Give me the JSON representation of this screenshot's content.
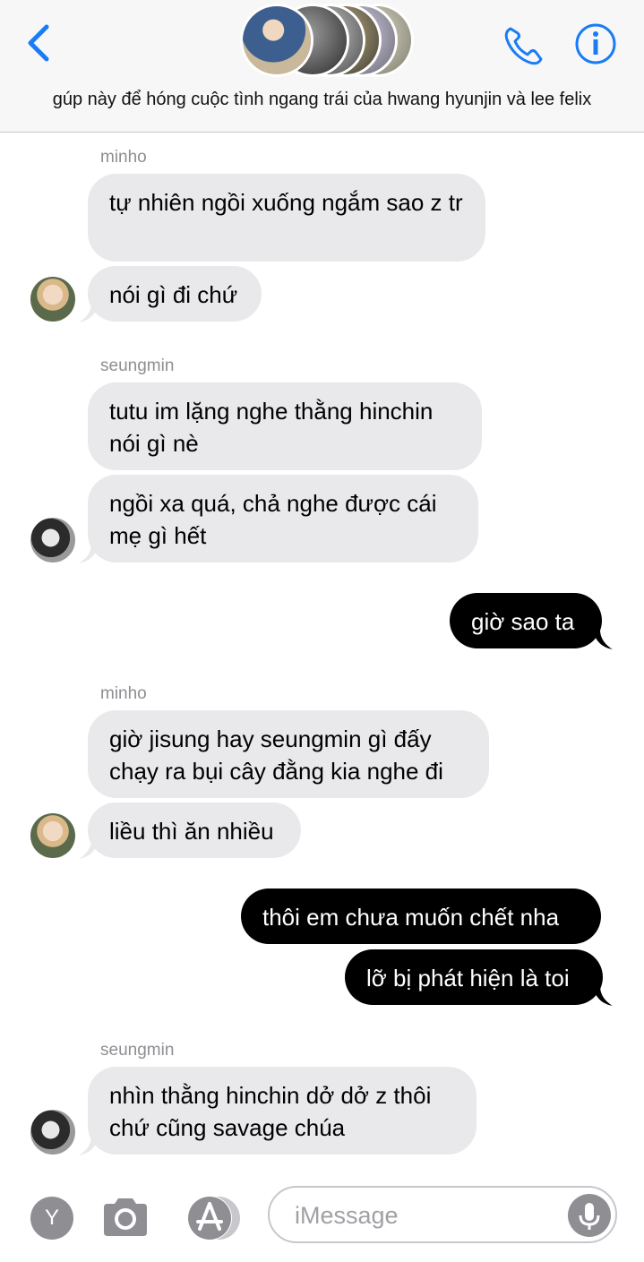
{
  "header": {
    "group_name": "gúp này để hóng cuộc tình ngang trái của hwang hyunjin và lee felix",
    "back_icon": "chevron-left-icon",
    "call_icon": "phone-icon",
    "info_icon": "info-icon",
    "accent_color": "#1a7cf5"
  },
  "messages": [
    {
      "sender": "minho",
      "direction": "in",
      "text": "tự nhiên ngồi xuống ngắm sao z tr"
    },
    {
      "sender": "minho",
      "direction": "in",
      "text": "nói gì đi chứ"
    },
    {
      "sender": "seungmin",
      "direction": "in",
      "text": "tutu im lặng nghe thằng hinchin nói gì nè"
    },
    {
      "sender": "seungmin",
      "direction": "in",
      "text": "ngồi xa quá, chả nghe được cái mẹ gì hết"
    },
    {
      "sender": "me",
      "direction": "out",
      "text": "giờ sao ta"
    },
    {
      "sender": "minho",
      "direction": "in",
      "text": "giờ jisung hay seungmin gì đấy chạy ra bụi cây đằng kia nghe đi"
    },
    {
      "sender": "minho",
      "direction": "in",
      "text": "liều thì ăn nhiều"
    },
    {
      "sender": "me",
      "direction": "out",
      "text": "thôi em chưa muốn chết nha"
    },
    {
      "sender": "me",
      "direction": "out",
      "text": "lỡ bị phát hiện là toi"
    },
    {
      "sender": "seungmin",
      "direction": "in",
      "text": "nhìn thằng hinchin dở dở z thôi chứ cũng savage chúa"
    }
  ],
  "composer": {
    "app_button_label": "Y",
    "placeholder": "iMessage",
    "camera_icon": "camera-icon",
    "appstore_icon": "app-store-icon",
    "mic_icon": "microphone-icon"
  },
  "colors": {
    "incoming_bubble": "#e9e9eb",
    "outgoing_bubble": "#000000",
    "sender_name": "#8e8e93"
  }
}
